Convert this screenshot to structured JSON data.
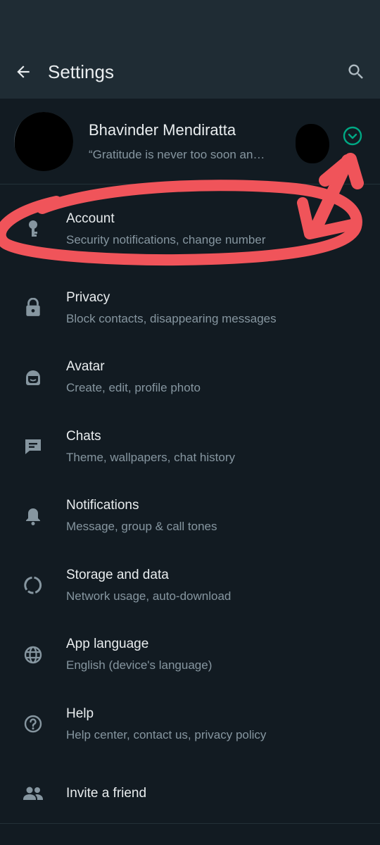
{
  "header": {
    "title": "Settings",
    "back_icon": "arrow-left-icon",
    "search_icon": "search-icon"
  },
  "profile": {
    "name": "Bhavinder Mendiratta",
    "status": "“Gratitude is never too soon an…",
    "expand_icon": "chevron-down-circle-icon"
  },
  "items": [
    {
      "label": "Account",
      "sub": "Security notifications, change number",
      "icon": "key-icon"
    },
    {
      "label": "Privacy",
      "sub": "Block contacts, disappearing messages",
      "icon": "lock-icon"
    },
    {
      "label": "Avatar",
      "sub": "Create, edit, profile photo",
      "icon": "avatar-face-icon"
    },
    {
      "label": "Chats",
      "sub": "Theme, wallpapers, chat history",
      "icon": "chat-icon"
    },
    {
      "label": "Notifications",
      "sub": "Message, group & call tones",
      "icon": "bell-icon"
    },
    {
      "label": "Storage and data",
      "sub": "Network usage, auto-download",
      "icon": "data-usage-icon"
    },
    {
      "label": "App language",
      "sub": "English (device's language)",
      "icon": "globe-icon"
    },
    {
      "label": "Help",
      "sub": "Help center, contact us, privacy policy",
      "icon": "help-circle-icon"
    },
    {
      "label": "Invite a friend",
      "sub": "",
      "icon": "people-icon"
    }
  ],
  "colors": {
    "background": "#121b22",
    "header": "#1f2c34",
    "accent": "#00a884",
    "annotation": "#f0545a",
    "secondary_text": "#8696a0"
  }
}
